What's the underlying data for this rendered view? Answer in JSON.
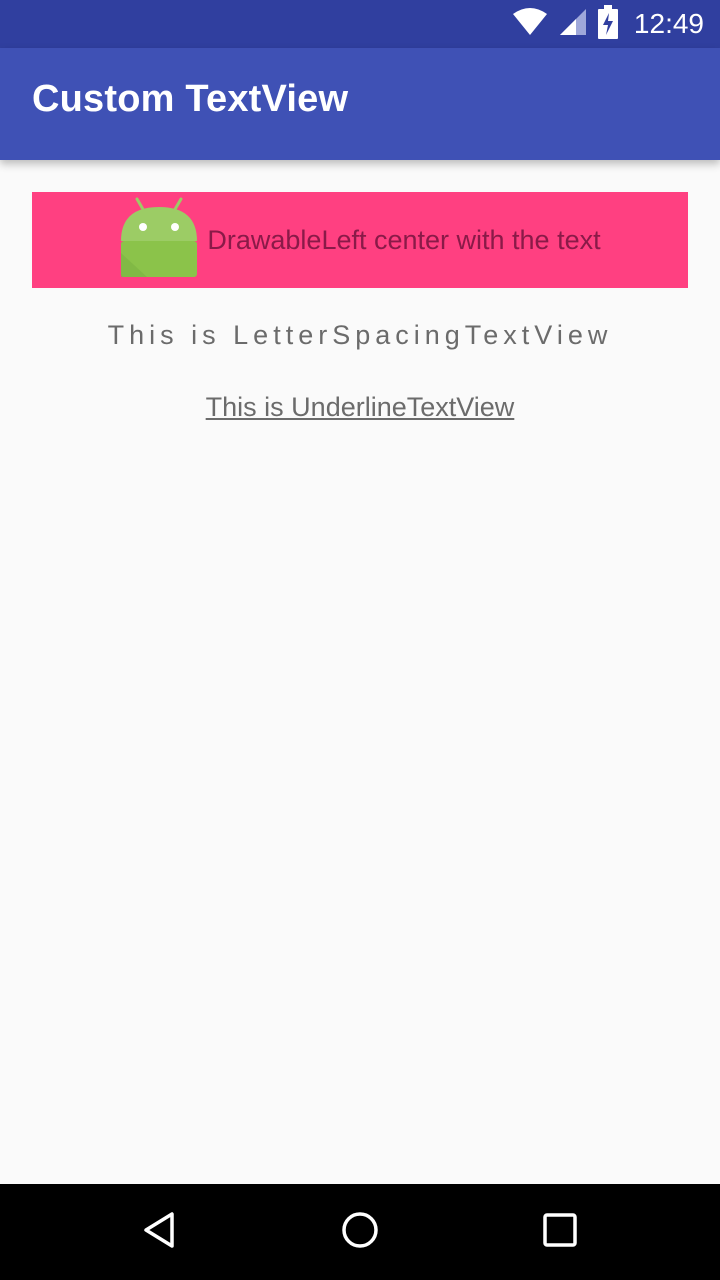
{
  "status_bar": {
    "time": "12:49",
    "icons": [
      "wifi-icon",
      "cellular-signal-icon",
      "battery-charging-icon"
    ]
  },
  "app_bar": {
    "title": "Custom TextView"
  },
  "content": {
    "drawable_left_text": "DrawableLeft center with the text",
    "letter_spacing_text": "This is LetterSpacingTextView",
    "underline_text": "This is UnderlineTextView"
  },
  "nav_bar": {
    "icons": [
      "back-icon",
      "home-icon",
      "recents-icon"
    ]
  },
  "colors": {
    "status_bar": "#303f9f",
    "primary": "#3f51b5",
    "accent": "#ff4081",
    "background": "#fafafa"
  }
}
